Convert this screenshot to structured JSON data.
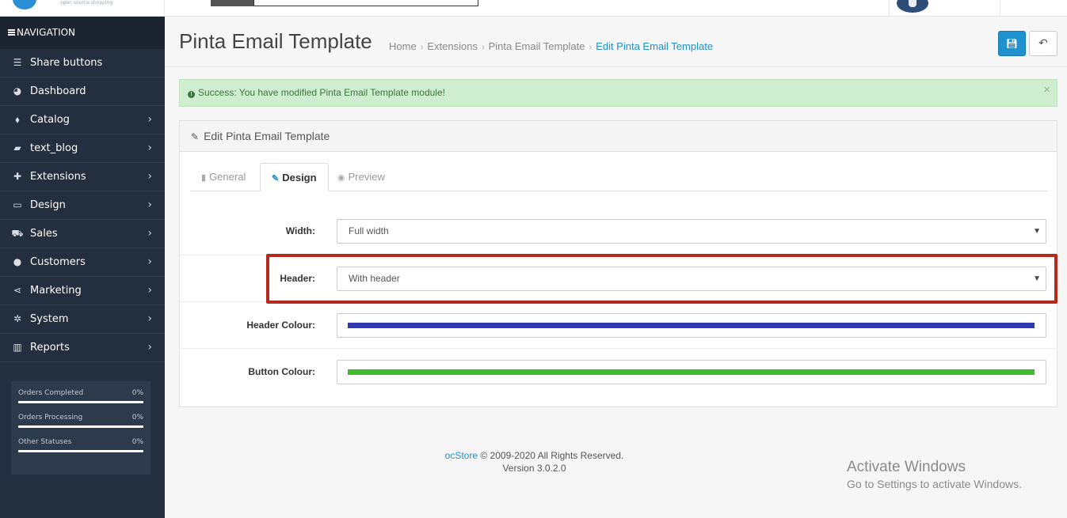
{
  "topbar": {
    "logo_tagline": "open source shopping"
  },
  "sidebar": {
    "heading": "NAVIGATION",
    "items": [
      {
        "label": "Share buttons",
        "icon": "list-icon",
        "glyph": "☰",
        "has_children": false
      },
      {
        "label": "Dashboard",
        "icon": "dashboard-icon",
        "glyph": "◕",
        "has_children": false
      },
      {
        "label": "Catalog",
        "icon": "tags-icon",
        "glyph": "⬧",
        "has_children": true
      },
      {
        "label": "text_blog",
        "icon": "book-icon",
        "glyph": "▰",
        "has_children": true
      },
      {
        "label": "Extensions",
        "icon": "puzzle-icon",
        "glyph": "✚",
        "has_children": true
      },
      {
        "label": "Design",
        "icon": "desktop-icon",
        "glyph": "▭",
        "has_children": true
      },
      {
        "label": "Sales",
        "icon": "cart-icon",
        "glyph": "⛟",
        "has_children": true
      },
      {
        "label": "Customers",
        "icon": "user-icon",
        "glyph": "●",
        "has_children": true
      },
      {
        "label": "Marketing",
        "icon": "share-icon",
        "glyph": "⋖",
        "has_children": true
      },
      {
        "label": "System",
        "icon": "cog-icon",
        "glyph": "✲",
        "has_children": true
      },
      {
        "label": "Reports",
        "icon": "bar-chart-icon",
        "glyph": "▥",
        "has_children": true
      }
    ],
    "stats": [
      {
        "label": "Orders Completed",
        "value": "0%"
      },
      {
        "label": "Orders Processing",
        "value": "0%"
      },
      {
        "label": "Other Statuses",
        "value": "0%"
      }
    ]
  },
  "header": {
    "title": "Pinta Email Template",
    "breadcrumb": [
      "Home",
      "Extensions",
      "Pinta Email Template",
      "Edit Pinta Email Template"
    ]
  },
  "alert": {
    "text": "Success: You have modified Pinta Email Template module!",
    "close": "×"
  },
  "panel": {
    "title": "Edit Pinta Email Template",
    "tabs": [
      {
        "label": "General",
        "active": false
      },
      {
        "label": "Design",
        "active": true
      },
      {
        "label": "Preview",
        "active": false
      }
    ],
    "fields": {
      "width": {
        "label": "Width:",
        "value": "Full width"
      },
      "header": {
        "label": "Header:",
        "value": "With header"
      },
      "header_colour": {
        "label": "Header Colour:",
        "color": "#3139b0"
      },
      "button_colour": {
        "label": "Button Colour:",
        "color": "#44bb2f"
      }
    }
  },
  "footer": {
    "brand": "ocStore",
    "copyright": " © 2009-2020 All Rights Reserved.",
    "version": "Version 3.0.2.0"
  },
  "watermark": {
    "line1": "Activate Windows",
    "line2": "Go to Settings to activate Windows."
  },
  "colors": {
    "sidebar_bg": "#232f3e",
    "accent": "#1e91cf",
    "alert_bg": "#cfedcf",
    "highlight": "#b52a1c"
  }
}
